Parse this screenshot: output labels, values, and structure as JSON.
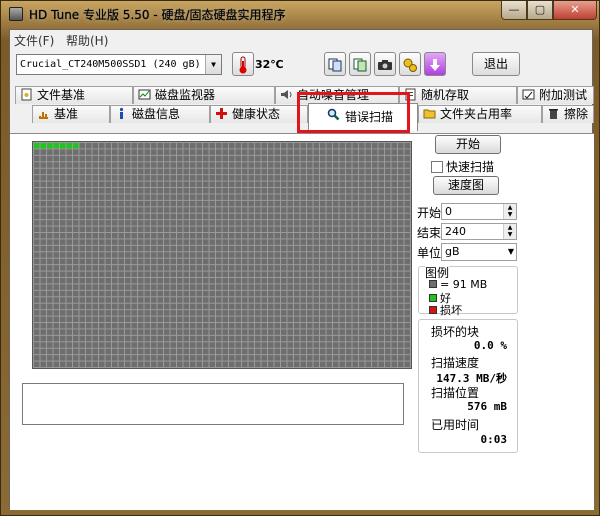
{
  "window": {
    "title": "HD Tune 专业版 5.50 - 硬盘/固态硬盘实用程序"
  },
  "window_controls": {
    "minimize": "—",
    "maximize": "▢",
    "close": "✕"
  },
  "menu": {
    "file": "文件(F)",
    "help": "帮助(H)"
  },
  "toolbar": {
    "drive": "Crucial_CT240M500SSD1 (240 gB)",
    "temperature": "32℃",
    "exit_label": "退出"
  },
  "tabs_top": [
    {
      "label": "文件基准",
      "icon": "file-benchmark-icon"
    },
    {
      "label": "磁盘监视器",
      "icon": "disk-monitor-icon"
    },
    {
      "label": "自动噪音管理",
      "icon": "speaker-icon"
    },
    {
      "label": "随机存取",
      "icon": "random-access-icon"
    },
    {
      "label": "附加测试",
      "icon": "extra-tests-icon"
    }
  ],
  "tabs_bottom": [
    {
      "label": "基准",
      "icon": "benchmark-icon"
    },
    {
      "label": "磁盘信息",
      "icon": "info-icon"
    },
    {
      "label": "健康状态",
      "icon": "health-cross-icon"
    },
    {
      "label": "错误扫描",
      "icon": "magnifier-icon",
      "active": true
    },
    {
      "label": "文件夹占用率",
      "icon": "folder-icon"
    },
    {
      "label": "擦除",
      "icon": "trash-icon"
    }
  ],
  "scan": {
    "start_button": "开始",
    "quick_scan_label": "快速扫描",
    "quick_scan_checked": false,
    "speed_map_button": "速度图",
    "start_label": "开始",
    "start_value": "0",
    "end_label": "结束",
    "end_value": "240",
    "unit_label": "单位",
    "unit_value": "gB",
    "grid_cols": 58,
    "grid_rows": 35,
    "good_blocks_scanned": 7
  },
  "legend": {
    "title": "图例",
    "block_size": "= 91 MB",
    "good": "好",
    "bad": "损坏",
    "colors": {
      "unscanned": "#6e6e6e",
      "good": "#1fc41f",
      "bad": "#d81515"
    }
  },
  "stats": {
    "damaged_label": "损坏的块",
    "damaged_value": "0.0 %",
    "speed_label": "扫描速度",
    "speed_value": "147.3 MB/秒",
    "position_label": "扫描位置",
    "position_value": "576 mB",
    "elapsed_label": "已用时间",
    "elapsed_value": "0:03"
  }
}
